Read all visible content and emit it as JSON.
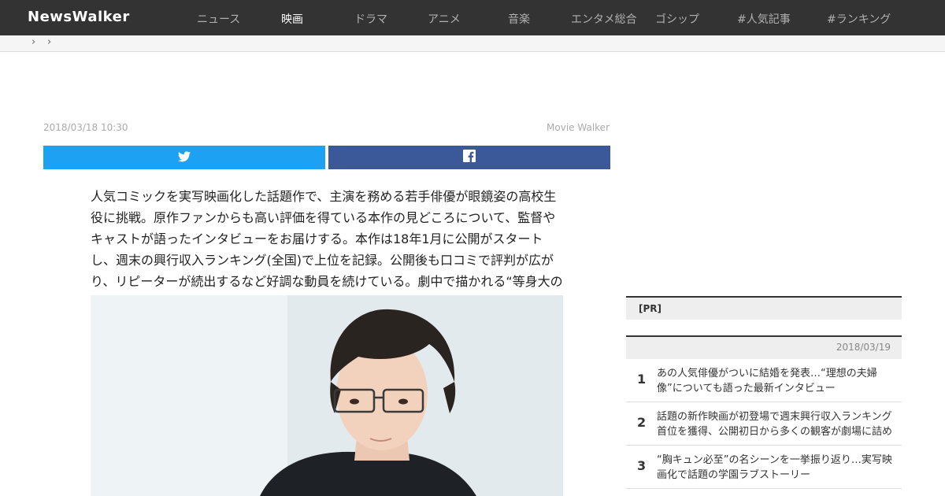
{
  "site": {
    "logo": "NewsWalker"
  },
  "nav": {
    "items": [
      {
        "label": "ニュース"
      },
      {
        "label": "映画"
      },
      {
        "label": "ドラマ"
      },
      {
        "label": "アニメ"
      },
      {
        "label": "音楽"
      },
      {
        "label": "エンタメ総合"
      },
      {
        "label": "ゴシップ"
      },
      {
        "label": "#人気記事"
      },
      {
        "label": "#ランキング"
      }
    ]
  },
  "breadcrumb": {
    "separator": "›"
  },
  "article": {
    "date": "2018/03/18 10:30",
    "source": "Movie Walker",
    "lead": "人気コミックを実写映画化した話題作で、主演を務める若手俳優が眼鏡姿の高校生役に挑戦。原作ファンからも高い評価を得ている本作の見どころについて、監督やキャストが語ったインタビューをお届けする。本作は18年1月に公開がスタートし、週末の興行収入ランキング(全国)で上位を記録。公開後も口コミで評判が広がり、リピーターが続出するなど好調な動員を続けている。劇中で描かれる“等身大の青春と恋の物語”が多くの観客の心をつかんでいるようだ。"
  },
  "share": {
    "twitter_icon": "twitter-icon",
    "facebook_icon": "facebook-icon"
  },
  "sidebar": {
    "pr_label": "[PR]",
    "ranking": {
      "date": "2018/03/19",
      "items": [
        {
          "rank": "1",
          "title": "あの人気俳優がついに結婚を発表…“理想の夫婦像”についても語った最新インタビュー"
        },
        {
          "rank": "2",
          "title": "話題の新作映画が初登場で週末興行収入ランキング首位を獲得、公開初日から多くの観客が劇場に詰めかけた"
        },
        {
          "rank": "3",
          "title": "“胸キュン必至”の名シーンを一挙振り返り…実写映画化で話題の学園ラブストーリー"
        }
      ]
    }
  },
  "colors": {
    "topnav_bg": "#333333",
    "twitter": "#1da1f2",
    "facebook": "#3b5998"
  }
}
